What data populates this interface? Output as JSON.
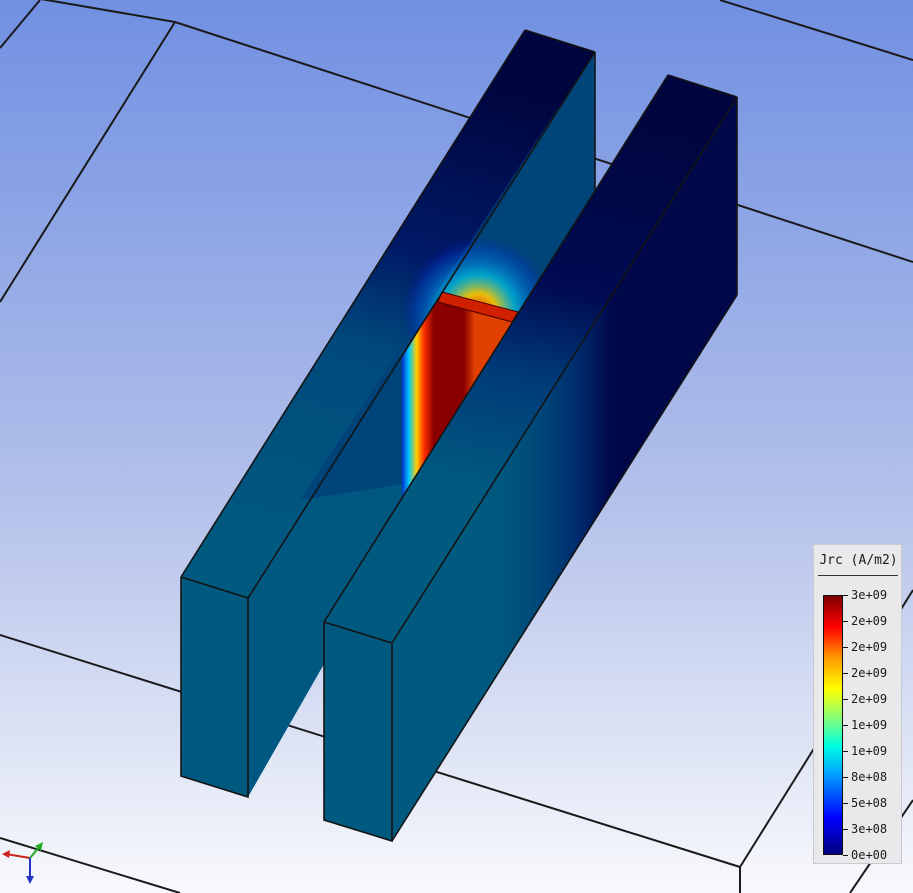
{
  "legend": {
    "title": "Jrc (A/m2)",
    "ticks": [
      "3e+09",
      "2e+09",
      "2e+09",
      "2e+09",
      "2e+09",
      "1e+09",
      "1e+09",
      "8e+08",
      "5e+08",
      "3e+08",
      "0e+00"
    ]
  },
  "colors": {
    "background_top": "#7190e2",
    "background_bottom": "#f8f9fc",
    "low_field": "#00084a",
    "mid_field": "#00587e",
    "hotspot": "#8a0000"
  },
  "icons": {
    "axis_triad": "xyz-axes-icon"
  }
}
